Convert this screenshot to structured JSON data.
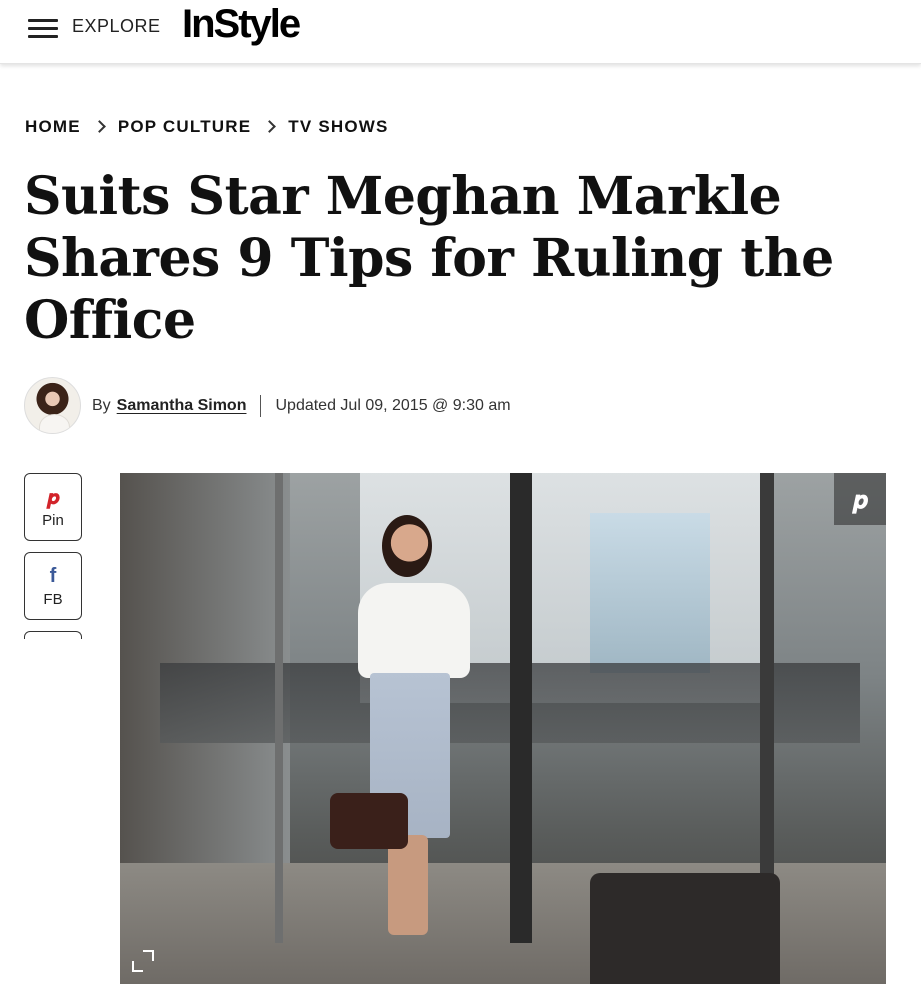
{
  "header": {
    "explore_label": "EXPLORE",
    "logo": "InStyle"
  },
  "breadcrumb": {
    "items": [
      "HOME",
      "POP CULTURE",
      "TV SHOWS"
    ]
  },
  "article": {
    "title": "Suits Star Meghan Markle Shares 9 Tips for Ruling the Office",
    "by_label": "By",
    "author": "Samantha Simon",
    "updated": "Updated Jul 09, 2015 @ 9:30 am"
  },
  "share": {
    "pin_label": "Pin",
    "fb_label": "FB"
  },
  "icons": {
    "menu": "hamburger-menu-icon",
    "pinterest": "pinterest-icon",
    "facebook": "facebook-icon",
    "expand": "expand-icon"
  },
  "colors": {
    "pinterest": "#d2232a",
    "facebook": "#3b5998"
  }
}
